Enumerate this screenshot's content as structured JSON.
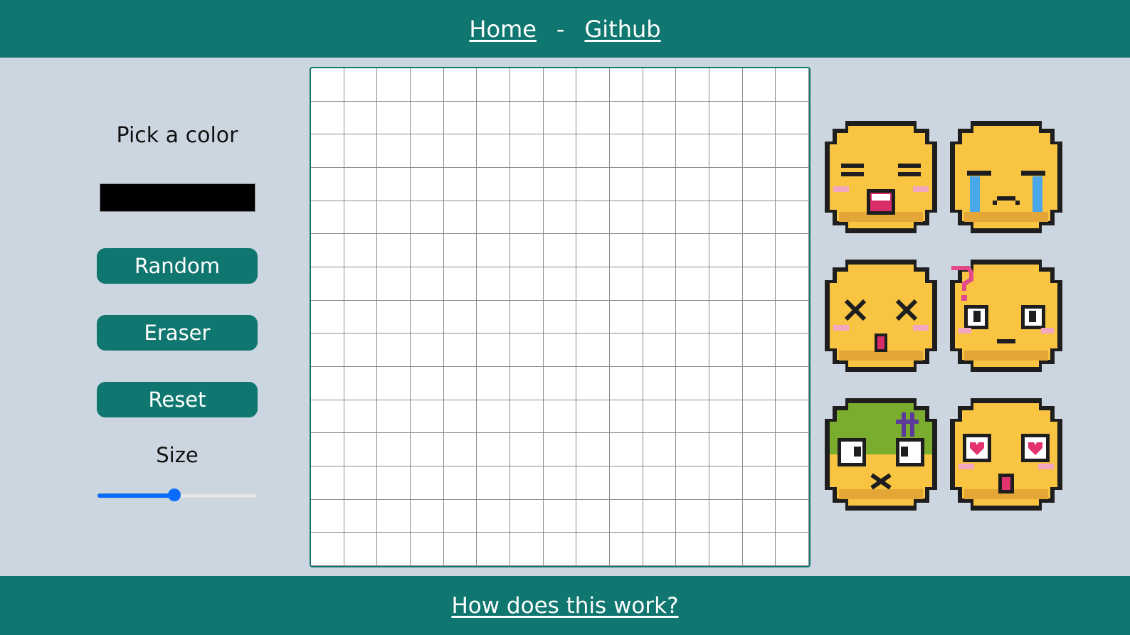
{
  "nav": {
    "home": "Home",
    "separator": "-",
    "github": "Github"
  },
  "controls": {
    "pick_label": "Pick a color",
    "current_color": "#000000",
    "random_label": "Random",
    "eraser_label": "Eraser",
    "reset_label": "Reset",
    "size_label": "Size",
    "size_fraction": 0.48
  },
  "grid": {
    "rows": 15,
    "cols": 15
  },
  "emojis": [
    {
      "name": "laughing-emoji-icon"
    },
    {
      "name": "crying-emoji-icon"
    },
    {
      "name": "dizzy-emoji-icon"
    },
    {
      "name": "confused-emoji-icon"
    },
    {
      "name": "zombie-emoji-icon"
    },
    {
      "name": "heart-eyes-emoji-icon"
    }
  ],
  "footer": {
    "link": "How does this work?"
  },
  "colors": {
    "brand": "#0f776f",
    "background": "#ccd6e0",
    "face": "#f9c442",
    "slider": "#0a6cff"
  }
}
